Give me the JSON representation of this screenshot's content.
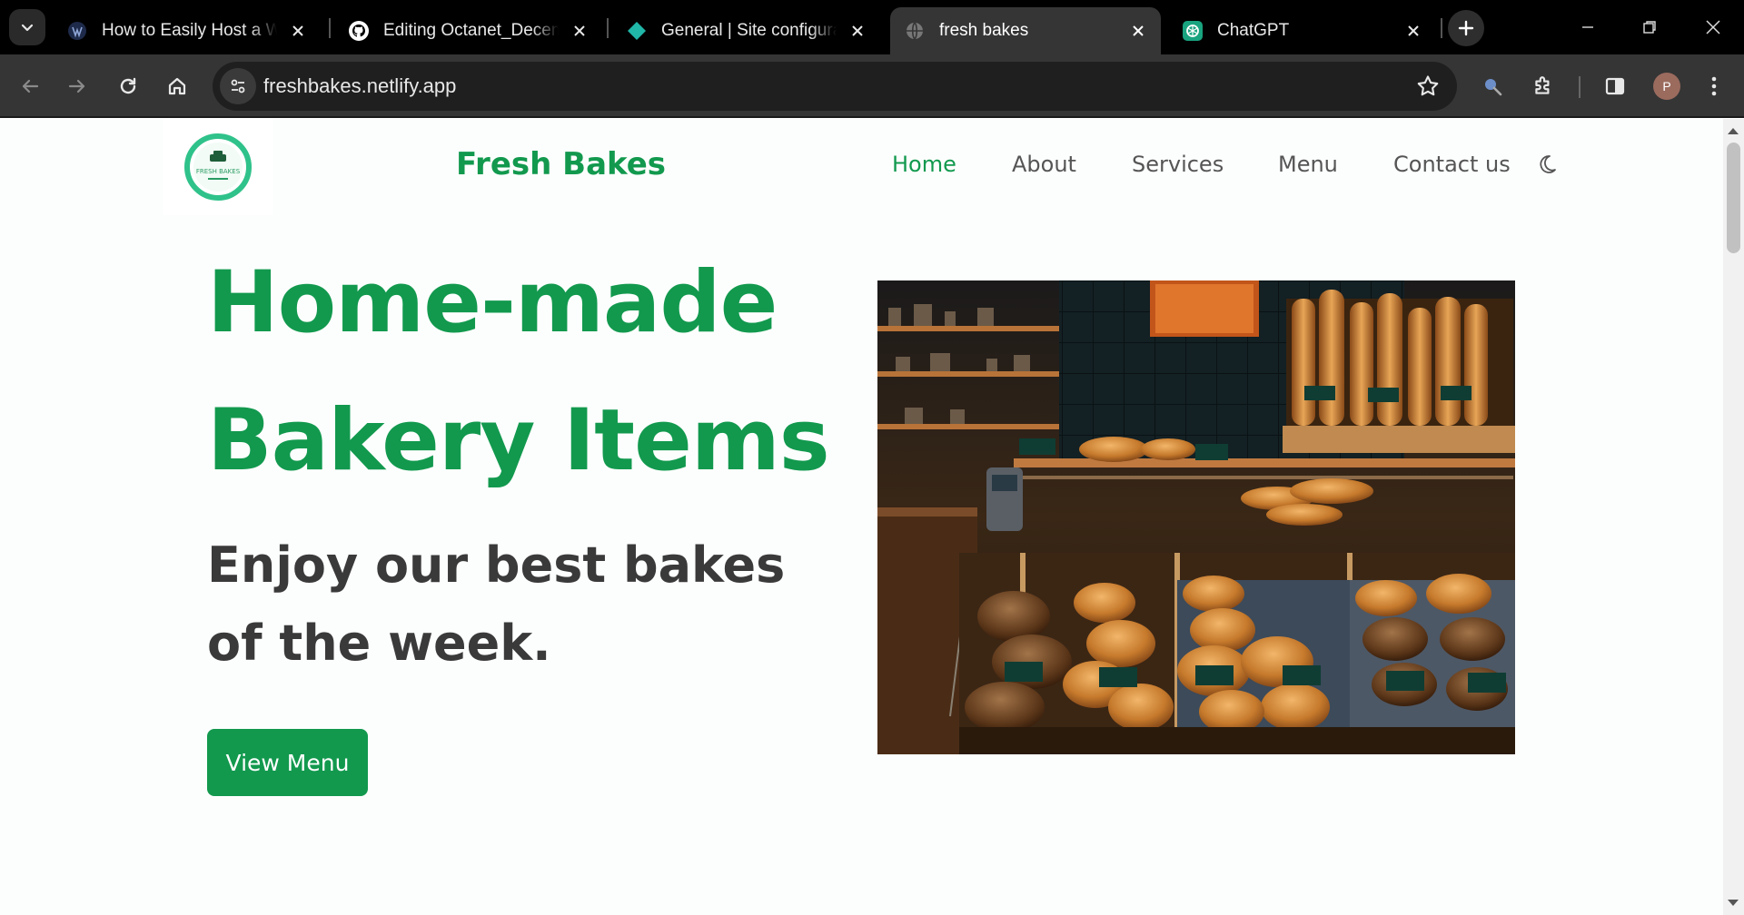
{
  "browser": {
    "tabs": [
      {
        "title": "How to Easily Host a Website",
        "active": false,
        "icon": "wordpress-icon"
      },
      {
        "title": "Editing Octanet_December",
        "active": false,
        "icon": "github-icon"
      },
      {
        "title": "General | Site configuration",
        "active": false,
        "icon": "netlify-icon"
      },
      {
        "title": "fresh bakes",
        "active": true,
        "icon": "globe-icon"
      },
      {
        "title": "ChatGPT",
        "active": false,
        "icon": "chatgpt-icon"
      }
    ],
    "url": "freshbakes.netlify.app",
    "profile_initial": "P"
  },
  "site": {
    "logo_text": "FRESH BAKES",
    "brand": "Fresh Bakes",
    "nav": [
      "Home",
      "About",
      "Services",
      "Menu",
      "Contact us"
    ],
    "active_nav": "Home",
    "hero": {
      "title_line1": "Home-made",
      "title_line2": "Bakery Items",
      "subtitle_line1": "Enjoy our best bakes",
      "subtitle_line2": "of the week.",
      "cta": "View Menu"
    }
  },
  "colors": {
    "brand_green": "#12994e",
    "text_dark": "#3a3a3a",
    "nav_gray": "#555555",
    "chrome_dark": "#000000",
    "chrome_toolbar": "#353535"
  }
}
